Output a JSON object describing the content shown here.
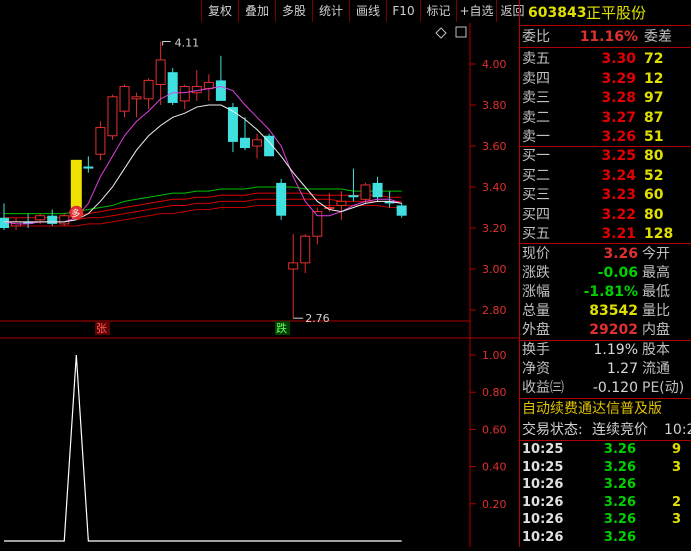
{
  "toolbar": {
    "buttons": [
      "复权",
      "叠加",
      "多股",
      "统计",
      "画线",
      "F10",
      "标记",
      "+自选",
      "返回"
    ]
  },
  "main_chart": {
    "price_axis": [
      "4.00",
      "3.80",
      "3.60",
      "3.40",
      "3.20",
      "3.00",
      "2.80"
    ],
    "high_label": "4.11",
    "low_label": "2.76",
    "badge_up": "张",
    "badge_down": "跌",
    "marker": "多"
  },
  "sub_chart": {
    "axis": [
      "1.00",
      "0.80",
      "0.60",
      "0.40",
      "0.20"
    ]
  },
  "chart_data": [
    {
      "type": "candlestick",
      "title": "",
      "ylim": [
        2.7,
        4.2
      ],
      "y_ticks": [
        4.0,
        3.8,
        3.6,
        3.4,
        3.2,
        3.0,
        2.8
      ],
      "candles": [
        {
          "o": 3.25,
          "h": 3.32,
          "l": 3.19,
          "c": 3.2
        },
        {
          "o": 3.21,
          "h": 3.25,
          "l": 3.19,
          "c": 3.23
        },
        {
          "o": 3.23,
          "h": 3.27,
          "l": 3.2,
          "c": 3.22
        },
        {
          "o": 3.24,
          "h": 3.27,
          "l": 3.22,
          "c": 3.26
        },
        {
          "o": 3.26,
          "h": 3.29,
          "l": 3.21,
          "c": 3.22
        },
        {
          "o": 3.22,
          "h": 3.27,
          "l": 3.21,
          "c": 3.26
        },
        {
          "o": 3.3,
          "h": 3.53,
          "l": 3.28,
          "c": 3.53
        },
        {
          "o": 3.5,
          "h": 3.55,
          "l": 3.47,
          "c": 3.49
        },
        {
          "o": 3.56,
          "h": 3.72,
          "l": 3.53,
          "c": 3.69
        },
        {
          "o": 3.65,
          "h": 3.85,
          "l": 3.63,
          "c": 3.84
        },
        {
          "o": 3.77,
          "h": 3.9,
          "l": 3.74,
          "c": 3.89
        },
        {
          "o": 3.83,
          "h": 3.86,
          "l": 3.74,
          "c": 3.84
        },
        {
          "o": 3.83,
          "h": 3.93,
          "l": 3.78,
          "c": 3.92
        },
        {
          "o": 3.9,
          "h": 4.11,
          "l": 3.8,
          "c": 4.02
        },
        {
          "o": 3.96,
          "h": 3.98,
          "l": 3.8,
          "c": 3.81
        },
        {
          "o": 3.82,
          "h": 3.9,
          "l": 3.78,
          "c": 3.89
        },
        {
          "o": 3.86,
          "h": 3.97,
          "l": 3.82,
          "c": 3.89
        },
        {
          "o": 3.88,
          "h": 3.95,
          "l": 3.82,
          "c": 3.91
        },
        {
          "o": 3.92,
          "h": 4.04,
          "l": 3.86,
          "c": 3.82
        },
        {
          "o": 3.79,
          "h": 3.81,
          "l": 3.57,
          "c": 3.62
        },
        {
          "o": 3.64,
          "h": 3.74,
          "l": 3.58,
          "c": 3.59
        },
        {
          "o": 3.6,
          "h": 3.66,
          "l": 3.54,
          "c": 3.63
        },
        {
          "o": 3.65,
          "h": 3.66,
          "l": 3.55,
          "c": 3.55
        },
        {
          "o": 3.42,
          "h": 3.44,
          "l": 3.24,
          "c": 3.26
        },
        {
          "o": 3.0,
          "h": 3.17,
          "l": 2.76,
          "c": 3.03
        },
        {
          "o": 3.03,
          "h": 3.17,
          "l": 2.98,
          "c": 3.16
        },
        {
          "o": 3.16,
          "h": 3.3,
          "l": 3.12,
          "c": 3.28
        },
        {
          "o": 3.3,
          "h": 3.37,
          "l": 3.28,
          "c": 3.3
        },
        {
          "o": 3.31,
          "h": 3.38,
          "l": 3.24,
          "c": 3.33
        },
        {
          "o": 3.36,
          "h": 3.49,
          "l": 3.33,
          "c": 3.35
        },
        {
          "o": 3.34,
          "h": 3.42,
          "l": 3.32,
          "c": 3.41
        },
        {
          "o": 3.42,
          "h": 3.45,
          "l": 3.33,
          "c": 3.35
        },
        {
          "o": 3.33,
          "h": 3.38,
          "l": 3.3,
          "c": 3.32
        },
        {
          "o": 3.31,
          "h": 3.32,
          "l": 3.25,
          "c": 3.26
        }
      ],
      "ma_fast": [
        3.23,
        3.22,
        3.22,
        3.23,
        3.23,
        3.23,
        3.25,
        3.32,
        3.45,
        3.55,
        3.65,
        3.72,
        3.77,
        3.83,
        3.86,
        3.86,
        3.87,
        3.88,
        3.89,
        3.87,
        3.8,
        3.74,
        3.68,
        3.6,
        3.45,
        3.33,
        3.26,
        3.26,
        3.28,
        3.31,
        3.33,
        3.34,
        3.34,
        3.32
      ],
      "ma_slow": [
        3.23,
        3.23,
        3.23,
        3.23,
        3.23,
        3.23,
        3.24,
        3.27,
        3.33,
        3.4,
        3.49,
        3.58,
        3.65,
        3.7,
        3.74,
        3.76,
        3.79,
        3.8,
        3.8,
        3.77,
        3.73,
        3.68,
        3.62,
        3.55,
        3.47,
        3.4,
        3.33,
        3.29,
        3.28,
        3.3,
        3.32,
        3.33,
        3.33,
        3.32
      ],
      "ma_long": [
        [
          3.27,
          3.27,
          3.27,
          3.27,
          3.27,
          3.27,
          3.28,
          3.29,
          3.3,
          3.31,
          3.33,
          3.34,
          3.35,
          3.36,
          3.37,
          3.37,
          3.38,
          3.38,
          3.39,
          3.39,
          3.39,
          3.4,
          3.4,
          3.4,
          3.4,
          3.39,
          3.39,
          3.39,
          3.39,
          3.38,
          3.38,
          3.38,
          3.38,
          3.38
        ],
        [
          3.25,
          3.25,
          3.25,
          3.25,
          3.25,
          3.25,
          3.26,
          3.27,
          3.28,
          3.29,
          3.3,
          3.31,
          3.32,
          3.33,
          3.34,
          3.34,
          3.35,
          3.35,
          3.36,
          3.36,
          3.36,
          3.37,
          3.37,
          3.37,
          3.37,
          3.37,
          3.36,
          3.36,
          3.36,
          3.36,
          3.36,
          3.36,
          3.35,
          3.35
        ],
        [
          3.23,
          3.23,
          3.23,
          3.23,
          3.23,
          3.23,
          3.24,
          3.25,
          3.25,
          3.26,
          3.27,
          3.28,
          3.29,
          3.3,
          3.31,
          3.31,
          3.32,
          3.32,
          3.33,
          3.33,
          3.33,
          3.34,
          3.34,
          3.34,
          3.34,
          3.34,
          3.34,
          3.34,
          3.33,
          3.33,
          3.33,
          3.33,
          3.33,
          3.33
        ],
        [
          3.21,
          3.21,
          3.21,
          3.21,
          3.21,
          3.21,
          3.21,
          3.22,
          3.22,
          3.23,
          3.24,
          3.25,
          3.26,
          3.27,
          3.27,
          3.28,
          3.29,
          3.29,
          3.3,
          3.3,
          3.3,
          3.31,
          3.31,
          3.31,
          3.31,
          3.31,
          3.31,
          3.31,
          3.31,
          3.31,
          3.31,
          3.31,
          3.3,
          3.3
        ]
      ]
    },
    {
      "type": "line",
      "title": "",
      "ylim": [
        0,
        1.05
      ],
      "y_ticks": [
        1.0,
        0.8,
        0.6,
        0.4,
        0.2
      ],
      "values": [
        0,
        0,
        0,
        0,
        0,
        0,
        1,
        0,
        0,
        0,
        0,
        0,
        0,
        0,
        0,
        0,
        0,
        0,
        0,
        0,
        0,
        0,
        0,
        0,
        0,
        0,
        0,
        0,
        0,
        0,
        0,
        0,
        0,
        0
      ]
    }
  ],
  "quote": {
    "code": "603843",
    "name": "正平股份",
    "weibi_label": "委比",
    "weibi_value": "11.16%",
    "weicha_label": "委差",
    "asks": [
      {
        "label": "卖五",
        "price": "3.30",
        "vol": "72"
      },
      {
        "label": "卖四",
        "price": "3.29",
        "vol": "12"
      },
      {
        "label": "卖三",
        "price": "3.28",
        "vol": "97"
      },
      {
        "label": "卖二",
        "price": "3.27",
        "vol": "87"
      },
      {
        "label": "卖一",
        "price": "3.26",
        "vol": "51"
      }
    ],
    "bids": [
      {
        "label": "买一",
        "price": "3.25",
        "vol": "80"
      },
      {
        "label": "买二",
        "price": "3.24",
        "vol": "52"
      },
      {
        "label": "买三",
        "price": "3.23",
        "vol": "60"
      },
      {
        "label": "买四",
        "price": "3.22",
        "vol": "80"
      },
      {
        "label": "买五",
        "price": "3.21",
        "vol": "128"
      }
    ],
    "stats": [
      {
        "l1": "现价",
        "v1": "3.26",
        "c1": "r",
        "l2": "今开"
      },
      {
        "l1": "涨跌",
        "v1": "-0.06",
        "c1": "g",
        "l2": "最高"
      },
      {
        "l1": "涨幅",
        "v1": "-1.81%",
        "c1": "g",
        "l2": "最低"
      },
      {
        "l1": "总量",
        "v1": "83542",
        "c1": "y",
        "l2": "量比"
      },
      {
        "l1": "外盘",
        "v1": "29202",
        "c1": "r",
        "l2": "内盘"
      }
    ],
    "stats2": [
      {
        "l1": "换手",
        "v1": "1.19%",
        "l2": "股本"
      },
      {
        "l1": "净资",
        "v1": "1.27",
        "l2": "流通"
      },
      {
        "l1": "收益㈢",
        "v1": "-0.120",
        "l2": "PE(动)"
      }
    ],
    "promo": "自动续费通达信普及版",
    "status_label": "交易状态:",
    "status_value": "连续竞价",
    "status_time": "10:2",
    "ticks": [
      {
        "t": "10:25",
        "p": "3.26",
        "v": "9"
      },
      {
        "t": "10:25",
        "p": "3.26",
        "v": "3"
      },
      {
        "t": "10:26",
        "p": "3.26",
        "v": ""
      },
      {
        "t": "10:26",
        "p": "3.26",
        "v": "2"
      },
      {
        "t": "10:26",
        "p": "3.26",
        "v": "3"
      },
      {
        "t": "10:26",
        "p": "3.26",
        "v": ""
      }
    ]
  }
}
